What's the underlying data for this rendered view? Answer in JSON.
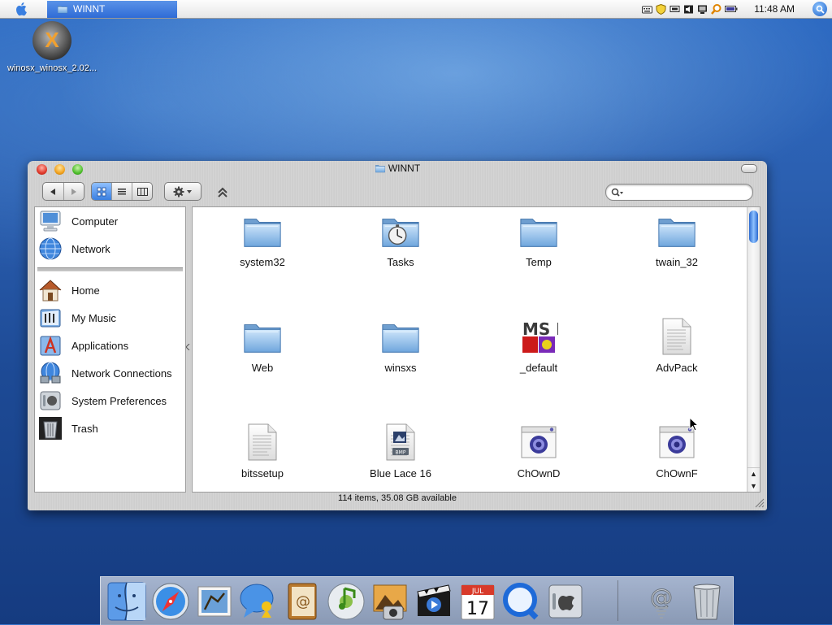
{
  "menubar": {
    "task_tab": "WINNT",
    "clock": "11:48 AM",
    "extras": [
      "keyboard-icon",
      "shield-icon",
      "display-icon",
      "volume-icon",
      "monitor-icon",
      "search-tool-icon",
      "battery-icon"
    ]
  },
  "desktop": {
    "icon_label": "winosx_winosx_2.02..."
  },
  "window": {
    "title": "WINNT",
    "status": "114 items, 35.08 GB available",
    "search": {
      "value": "",
      "placeholder": ""
    },
    "view_mode": "icons"
  },
  "sidebar": {
    "devices": [
      {
        "label": "Computer",
        "icon": "computer-icon"
      },
      {
        "label": "Network",
        "icon": "network-globe-icon"
      }
    ],
    "places": [
      {
        "label": "Home",
        "icon": "home-icon"
      },
      {
        "label": "My Music",
        "icon": "music-folder-icon"
      },
      {
        "label": "Applications",
        "icon": "applications-icon"
      },
      {
        "label": "Network Connections",
        "icon": "network-connections-icon"
      },
      {
        "label": "System Preferences",
        "icon": "system-preferences-icon"
      },
      {
        "label": "Trash",
        "icon": "trash-icon"
      }
    ]
  },
  "files": [
    {
      "label": "system32",
      "icon": "folder-icon"
    },
    {
      "label": "Tasks",
      "icon": "tasks-folder-icon"
    },
    {
      "label": "Temp",
      "icon": "folder-icon"
    },
    {
      "label": "twain_32",
      "icon": "folder-icon"
    },
    {
      "label": "Web",
      "icon": "folder-icon"
    },
    {
      "label": "winsxs",
      "icon": "folder-icon"
    },
    {
      "label": "_default",
      "icon": "msdos-icon",
      "logo_text": "MS DOS"
    },
    {
      "label": "AdvPack",
      "icon": "document-icon"
    },
    {
      "label": "bitssetup",
      "icon": "document-icon"
    },
    {
      "label": "Blue Lace 16",
      "icon": "bmp-document-icon",
      "badge": "BMP"
    },
    {
      "label": "ChOwnD",
      "icon": "executable-icon"
    },
    {
      "label": "ChOwnF",
      "icon": "executable-icon"
    }
  ],
  "dock": {
    "items": [
      "finder-icon",
      "safari-icon",
      "mail-icon",
      "ichat-icon",
      "address-book-icon",
      "itunes-icon",
      "iphoto-icon",
      "imovie-icon",
      "ical-icon",
      "quicktime-icon",
      "system-preferences-icon",
      "mail-at-icon",
      "trash-icon"
    ],
    "ical_month": "JUL",
    "ical_day": "17"
  },
  "colors": {
    "desktop_blue": "#2b5fb0",
    "selection_blue": "#3a7fe0",
    "folder_blue": "#8cc0ec"
  }
}
